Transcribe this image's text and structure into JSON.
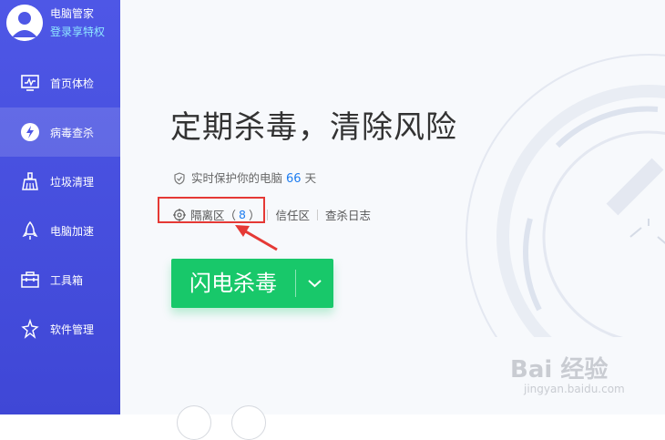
{
  "profile": {
    "name": "电脑管家",
    "login": "登录享特权"
  },
  "nav": [
    {
      "label": "首页体检",
      "icon": "monitor-icon"
    },
    {
      "label": "病毒查杀",
      "icon": "lightning-shield-icon"
    },
    {
      "label": "垃圾清理",
      "icon": "broom-icon"
    },
    {
      "label": "电脑加速",
      "icon": "rocket-icon"
    },
    {
      "label": "工具箱",
      "icon": "toolbox-icon"
    },
    {
      "label": "软件管理",
      "icon": "software-icon"
    }
  ],
  "main": {
    "headline": "定期杀毒，清除风险",
    "protect_prefix": "实时保护你的电脑",
    "protect_days": "66",
    "protect_unit": "天",
    "quarantine_label": "隔离区（",
    "quarantine_count": "8",
    "quarantine_close": "）",
    "trust_label": "信任区",
    "log_label": "查杀日志",
    "scan_button": "闪电杀毒"
  },
  "watermark": {
    "line1": "Bai 经验",
    "line2": "jingyan.baidu.com"
  },
  "colors": {
    "sidebar": "#4e57e6",
    "accent_green": "#18c86a",
    "link_blue": "#1e7df0",
    "highlight_red": "#e53935"
  }
}
